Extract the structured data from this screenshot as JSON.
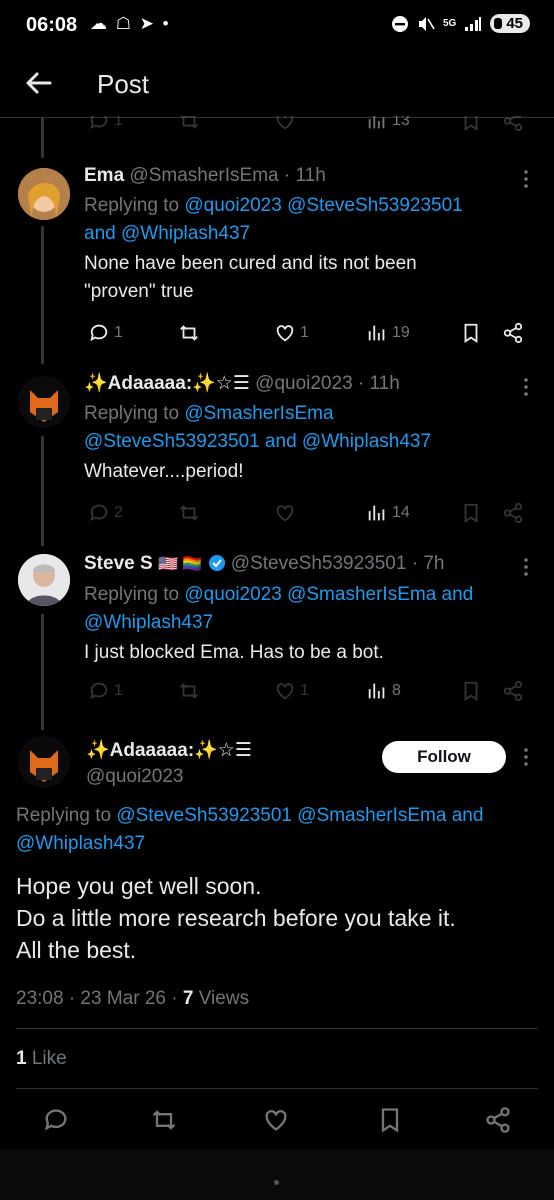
{
  "status_bar": {
    "time": "06:08",
    "left_icons": "☁ ☖ ➤ •",
    "signal": "5G",
    "battery": "45"
  },
  "header": {
    "title": "Post"
  },
  "top_partial_actions": {
    "reply": "1",
    "like": "",
    "views": "13"
  },
  "tweets": [
    {
      "name": "Ema",
      "handle": "@SmasherIsEma · 11h",
      "replying_prefix": "Replying to ",
      "mentions_line1": "@quoi2023 @SteveSh53923501",
      "and": "and ",
      "mentions_line2": "@Whiplash437",
      "text_line1": "None have been cured and its not been",
      "text_line2": "\"proven\" true",
      "reply_count": "1",
      "like_count": "1",
      "views": "19"
    },
    {
      "name": "✨Adaaaaa:✨☆☰",
      "handle": "@quoi2023 · 11h",
      "replying_prefix": "Replying to ",
      "mentions_line1": "@SmasherIsEma",
      "mentions_line2a": "@SteveSh53923501",
      "and": " and ",
      "mentions_line2b": "@Whiplash437",
      "text_line1": "Whatever....period!",
      "reply_count": "2",
      "views": "14"
    },
    {
      "name": "Steve S",
      "flags": "🇺🇸 🏳️‍🌈",
      "handle": "@SteveSh53923501 · 7h",
      "replying_prefix": "Replying to ",
      "mentions_line1": "@quoi2023 @SmasherIsEma",
      "and": " and",
      "mentions_line2": "@Whiplash437",
      "text_line1": "I just blocked Ema.  Has to be a bot.",
      "reply_count": "1",
      "like_count": "1",
      "views": "8"
    }
  ],
  "main_tweet": {
    "name": "✨Adaaaaa:✨☆☰",
    "handle": "@quoi2023",
    "follow_label": "Follow",
    "replying_prefix": "Replying to ",
    "mentions_line1": "@SteveSh53923501 @SmasherIsEma",
    "and": " and",
    "mentions_line2": "@Whiplash437",
    "text_line1": "Hope you get well soon.",
    "text_line2": "Do a little more research before you take it.",
    "text_line3": "All the best.",
    "timestamp": "23:08 · 23 Mar 26 · ",
    "views_count": "7",
    "views_label": " Views",
    "likes_count": "1",
    "likes_label": " Like"
  },
  "colors": {
    "accent": "#1d9bf0",
    "muted": "#71767b",
    "text": "#e7e9ea",
    "bg": "#000000"
  }
}
